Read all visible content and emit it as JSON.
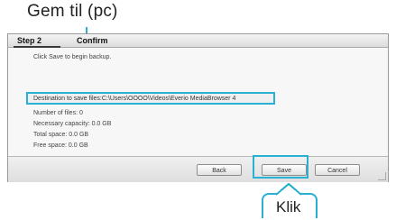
{
  "callouts": {
    "top_label": "Gem til (pc)",
    "bottom_label": "Klik"
  },
  "wizard": {
    "tabs": [
      "Step 2",
      "Confirm"
    ],
    "lines": [
      "Click Save to begin backup.",
      "Destination to save files:C:\\Users\\OOOO\\Videos\\Everio MediaBrowser 4",
      "Number of files: 0",
      "Necessary capacity: 0.0 GB",
      "Total space: 0.0 GB",
      "Free space: 0.0 GB"
    ],
    "buttons": {
      "back": "Back",
      "save": "Save",
      "cancel": "Cancel"
    }
  },
  "colors": {
    "accent": "#2ab0d2"
  }
}
